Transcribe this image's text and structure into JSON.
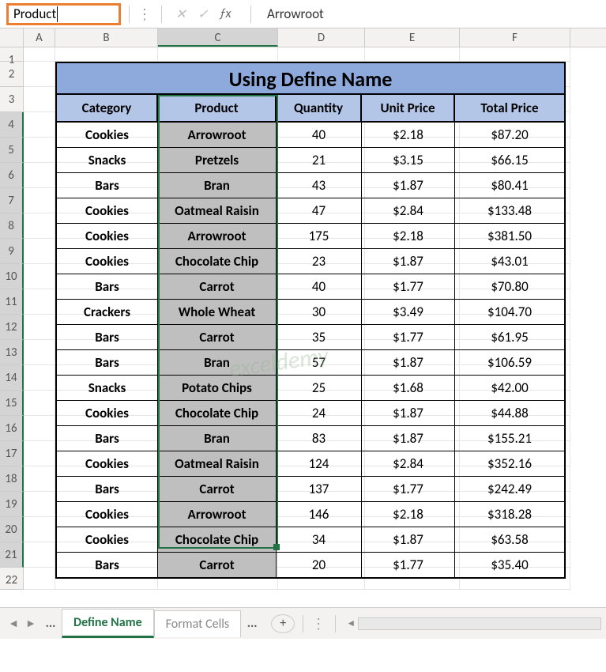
{
  "name_box": "Product",
  "formula_value": "Arrowroot",
  "columns": [
    "A",
    "B",
    "C",
    "D",
    "E",
    "F"
  ],
  "active_col": "C",
  "row_count": 22,
  "selected_rows": [
    4,
    5,
    6,
    7,
    8,
    9,
    10,
    11,
    12,
    13,
    14,
    15,
    16,
    17,
    18,
    19,
    20,
    21
  ],
  "title": "Using Define Name",
  "headers": {
    "cat": "Category",
    "prod": "Product",
    "qty": "Quantity",
    "unit": "Unit Price",
    "tot": "Total Price"
  },
  "rows": [
    {
      "cat": "Cookies",
      "prod": "Arrowroot",
      "qty": "40",
      "unit": "$2.18",
      "tot": "$87.20"
    },
    {
      "cat": "Snacks",
      "prod": "Pretzels",
      "qty": "21",
      "unit": "$3.15",
      "tot": "$66.15"
    },
    {
      "cat": "Bars",
      "prod": "Bran",
      "qty": "43",
      "unit": "$1.87",
      "tot": "$80.41"
    },
    {
      "cat": "Cookies",
      "prod": "Oatmeal Raisin",
      "qty": "47",
      "unit": "$2.84",
      "tot": "$133.48"
    },
    {
      "cat": "Cookies",
      "prod": "Arrowroot",
      "qty": "175",
      "unit": "$2.18",
      "tot": "$381.50"
    },
    {
      "cat": "Cookies",
      "prod": "Chocolate Chip",
      "qty": "23",
      "unit": "$1.87",
      "tot": "$43.01"
    },
    {
      "cat": "Bars",
      "prod": "Carrot",
      "qty": "40",
      "unit": "$1.77",
      "tot": "$70.80"
    },
    {
      "cat": "Crackers",
      "prod": "Whole Wheat",
      "qty": "30",
      "unit": "$3.49",
      "tot": "$104.70"
    },
    {
      "cat": "Bars",
      "prod": "Carrot",
      "qty": "35",
      "unit": "$1.77",
      "tot": "$61.95"
    },
    {
      "cat": "Bars",
      "prod": "Bran",
      "qty": "57",
      "unit": "$1.87",
      "tot": "$106.59"
    },
    {
      "cat": "Snacks",
      "prod": "Potato Chips",
      "qty": "25",
      "unit": "$1.68",
      "tot": "$42.00"
    },
    {
      "cat": "Cookies",
      "prod": "Chocolate Chip",
      "qty": "24",
      "unit": "$1.87",
      "tot": "$44.88"
    },
    {
      "cat": "Bars",
      "prod": "Bran",
      "qty": "83",
      "unit": "$1.87",
      "tot": "$155.21"
    },
    {
      "cat": "Cookies",
      "prod": "Oatmeal Raisin",
      "qty": "124",
      "unit": "$2.84",
      "tot": "$352.16"
    },
    {
      "cat": "Bars",
      "prod": "Carrot",
      "qty": "137",
      "unit": "$1.77",
      "tot": "$242.49"
    },
    {
      "cat": "Cookies",
      "prod": "Arrowroot",
      "qty": "146",
      "unit": "$2.18",
      "tot": "$318.28"
    },
    {
      "cat": "Cookies",
      "prod": "Chocolate Chip",
      "qty": "34",
      "unit": "$1.87",
      "tot": "$63.58"
    },
    {
      "cat": "Bars",
      "prod": "Carrot",
      "qty": "20",
      "unit": "$1.77",
      "tot": "$35.40"
    }
  ],
  "tabs": {
    "active": "Define Name",
    "inactive": "Format Cells",
    "ellipsis": "...",
    "add": "+"
  },
  "watermark": "exceldemy"
}
